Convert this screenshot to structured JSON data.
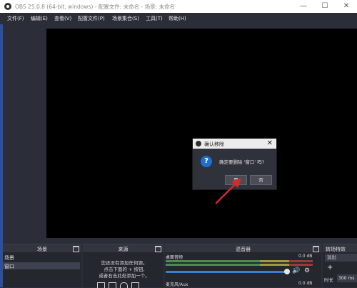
{
  "window": {
    "title": "OBS 25.0.8 (64-bit, windows) - 配置文件: 未命名 - 场景: 未命名",
    "minimize_icon": "—",
    "maximize_icon": "☐",
    "close_icon": "✕"
  },
  "menu": [
    {
      "label": "文件(F)"
    },
    {
      "label": "编辑(E)"
    },
    {
      "label": "查看(V)"
    },
    {
      "label": "配置文件(P)"
    },
    {
      "label": "场景集合(S)"
    },
    {
      "label": "工具(T)"
    },
    {
      "label": "帮助(H)"
    }
  ],
  "dialog": {
    "title": "确认移除",
    "message": "确定要删除 '窗口' 吗?",
    "icon": "?",
    "close_icon": "✕",
    "yes_label": "是",
    "no_label": "否"
  },
  "docks": {
    "scenes": {
      "title": "场景",
      "items": [
        "场景",
        "窗口"
      ],
      "selected": "窗口"
    },
    "sources": {
      "title": "来源",
      "empty_lines": [
        "您还没有添加任何源。",
        "点击下面的 + 按钮,",
        "或者右击此处添加一个。"
      ]
    },
    "mixer": {
      "title": "混音器",
      "channels": [
        {
          "name": "桌面音频",
          "level": "0.0 dB"
        },
        {
          "name": "麦克风/Aux",
          "level": "0.0 dB"
        }
      ],
      "volume_icon": "🔊",
      "gear_icon": "⚙"
    },
    "transitions": {
      "title": "转场特效",
      "selected": "淡出",
      "add_icon": "+",
      "duration_label": "时长",
      "duration_value": "300 ms"
    }
  },
  "colors": {
    "background": "#2b2e38",
    "accent_blue": "#2d4f9c",
    "arrow_red": "#d42a2a"
  }
}
